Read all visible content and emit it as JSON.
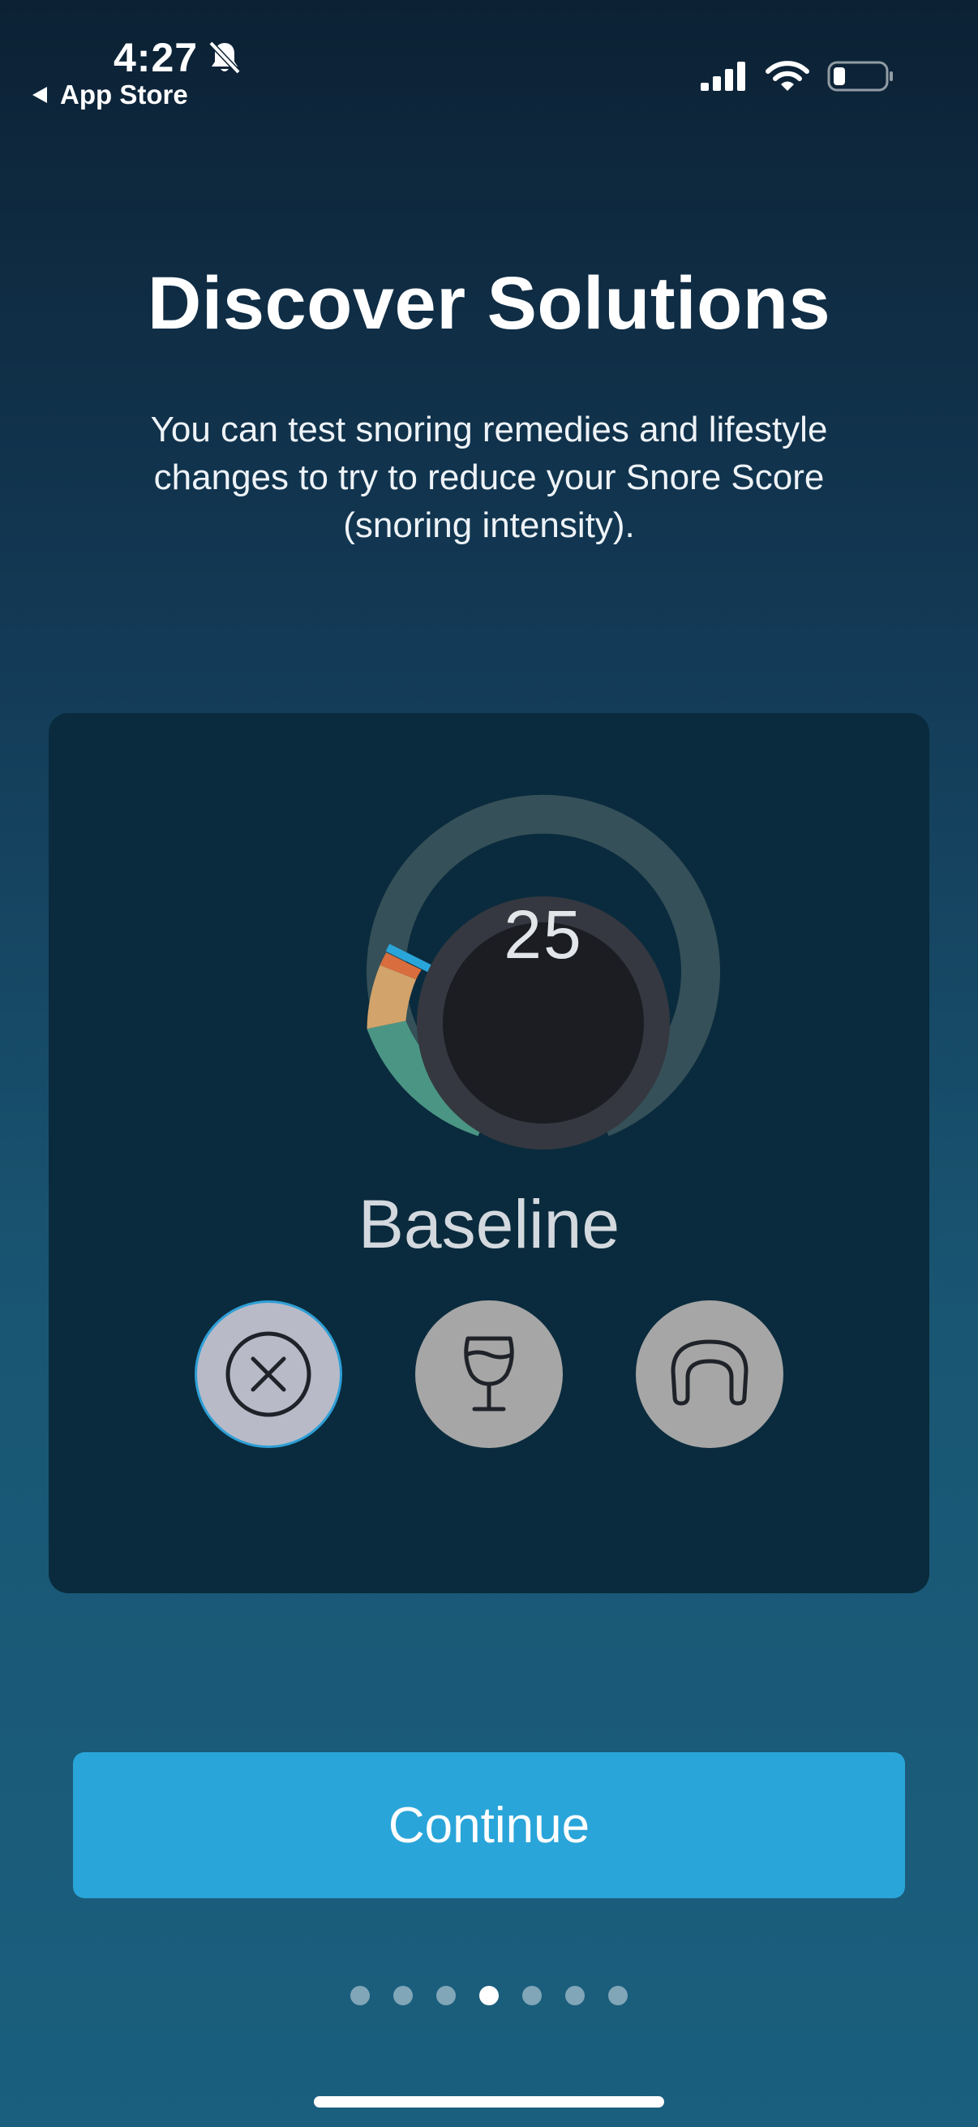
{
  "status_bar": {
    "time": "4:27",
    "back_label": "App Store"
  },
  "title": "Discover Solutions",
  "subtitle": "You can test snoring remedies and lifestyle changes to try to reduce your Snore Score (snoring intensity).",
  "score_card": {
    "score": "25",
    "label": "Baseline",
    "remedies": [
      {
        "icon": "close-circle-icon",
        "selected": true
      },
      {
        "icon": "wine-glass-icon",
        "selected": false
      },
      {
        "icon": "mouthguard-icon",
        "selected": false
      }
    ],
    "gauge_colors": {
      "track": "#355058",
      "quiet": "#4b9584",
      "light": "#d2a36a",
      "loud": "#d96d3d",
      "needle": "#2aa5d9"
    }
  },
  "continue_label": "Continue",
  "pagination": {
    "total": 7,
    "current": 4
  },
  "colors": {
    "accent": "#2aa5d9",
    "card_background": "#0a2b3d"
  }
}
